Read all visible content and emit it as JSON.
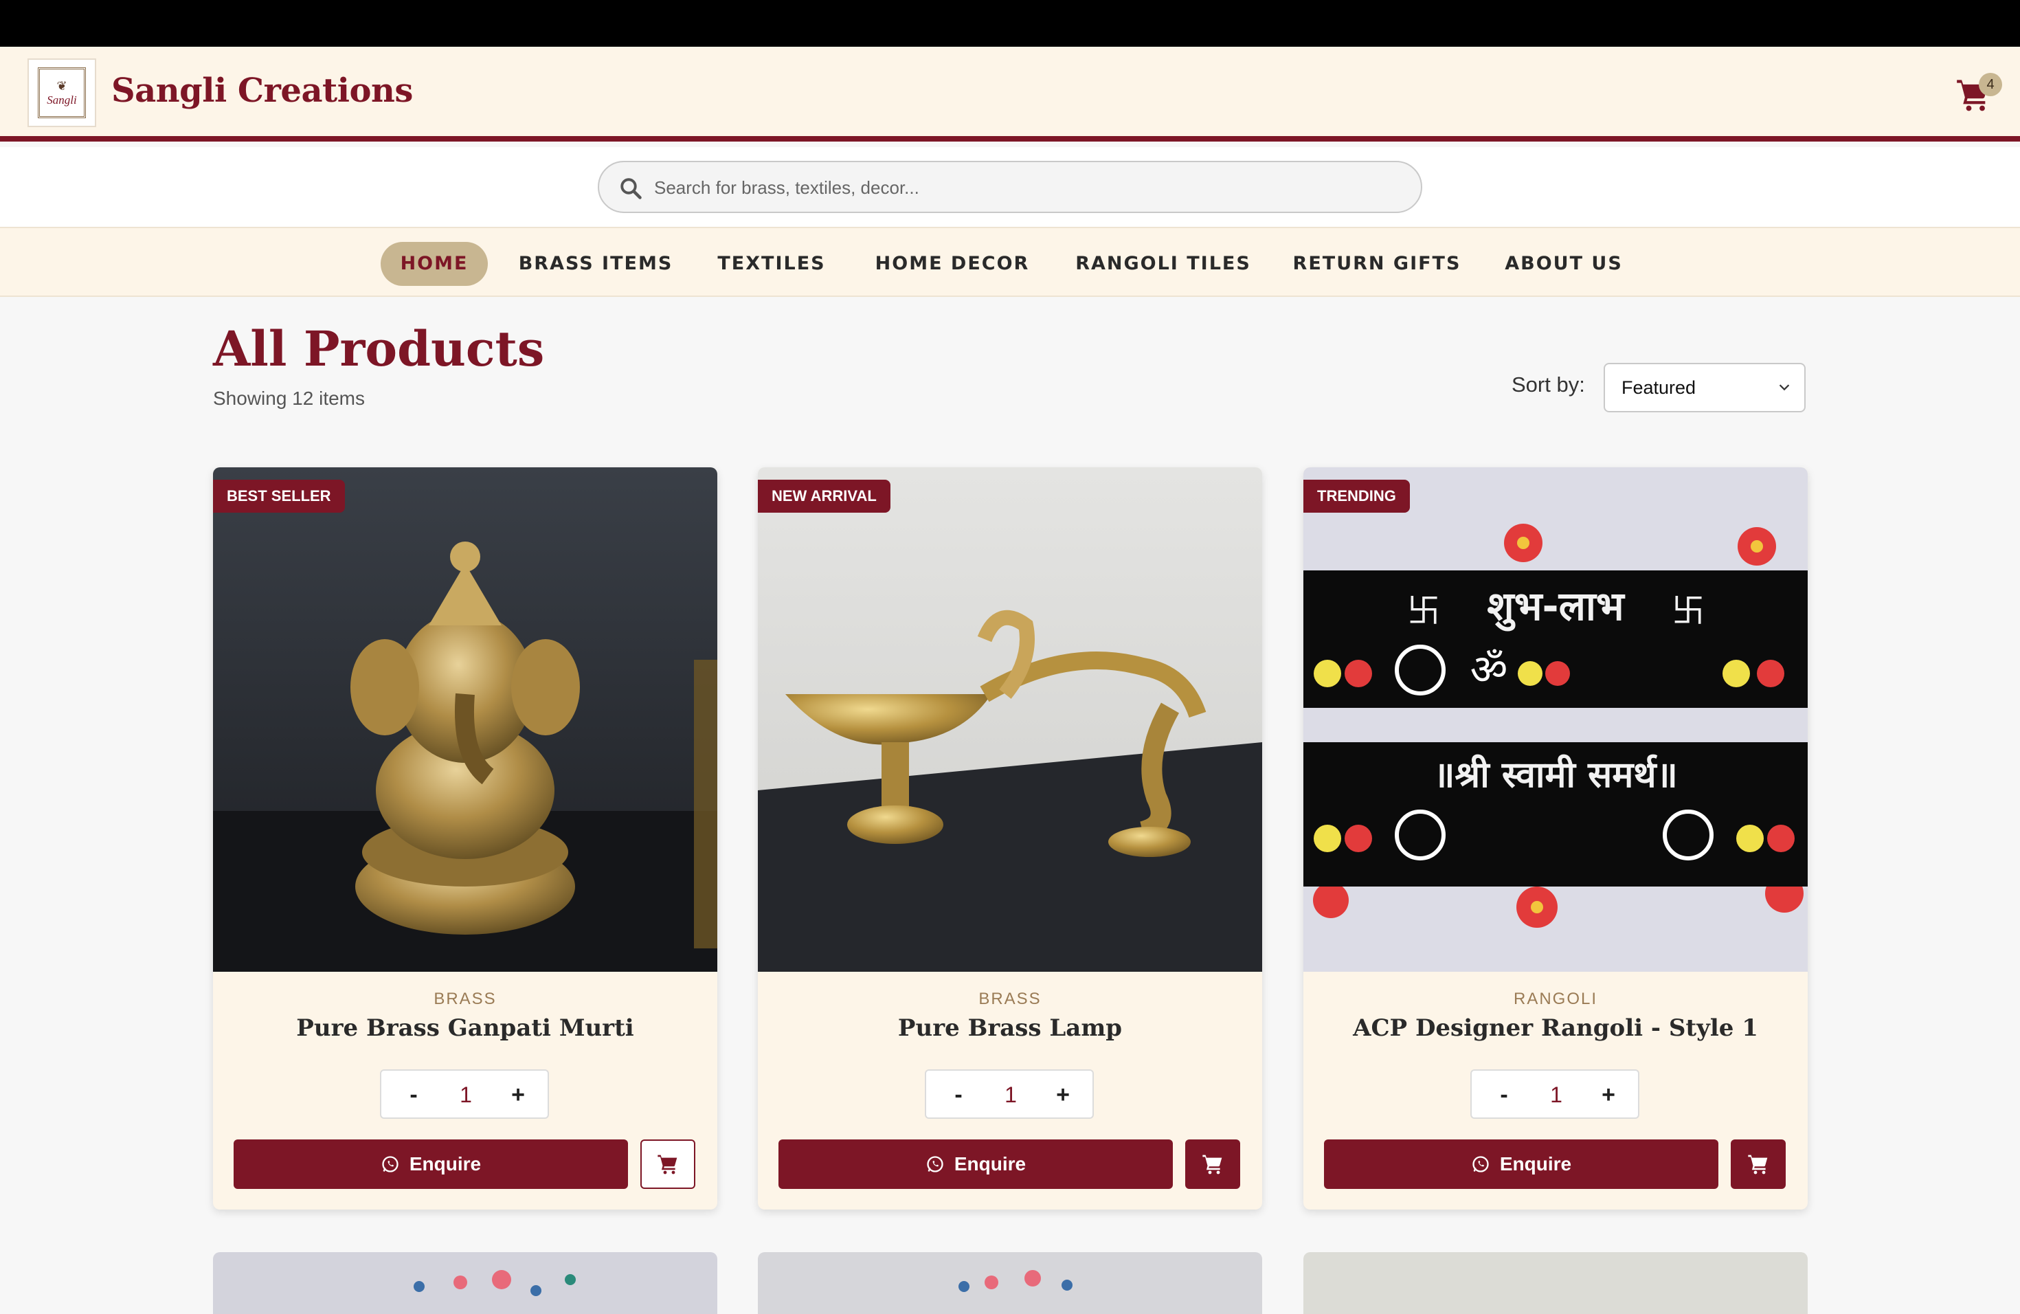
{
  "header": {
    "logo_text": "Sangli",
    "brand": "Sangli Creations",
    "cart_count": "4"
  },
  "search": {
    "placeholder": "Search for brass, textiles, decor...",
    "value": ""
  },
  "nav": {
    "items": [
      {
        "label": "HOME",
        "active": true
      },
      {
        "label": "BRASS ITEMS",
        "active": false
      },
      {
        "label": "TEXTILES",
        "active": false
      },
      {
        "label": "HOME DECOR",
        "active": false
      },
      {
        "label": "RANGOLI TILES",
        "active": false
      },
      {
        "label": "RETURN GIFTS",
        "active": false
      },
      {
        "label": "ABOUT US",
        "active": false
      }
    ]
  },
  "listing": {
    "title": "All Products",
    "count": "Showing 12 items",
    "sort_label": "Sort by:",
    "sort_value": "Featured"
  },
  "products": [
    {
      "tag": "BEST SELLER",
      "category": "BRASS",
      "name": "Pure Brass Ganpati Murti",
      "qty": "1",
      "enquire": "Enquire"
    },
    {
      "tag": "NEW ARRIVAL",
      "category": "BRASS",
      "name": "Pure Brass Lamp",
      "qty": "1",
      "enquire": "Enquire"
    },
    {
      "tag": "TRENDING",
      "category": "RANGOLI",
      "name": "ACP Designer Rangoli - Style 1",
      "qty": "1",
      "enquire": "Enquire"
    }
  ],
  "rangoli_text": {
    "line1": "शुभ-लाभ",
    "line2": "॥श्री स्वामी समर्थ॥"
  },
  "icons": {
    "cart": "shopping-cart-icon",
    "search": "search-icon",
    "whatsapp": "whatsapp-icon",
    "chevron": "chevron-down-icon"
  },
  "colors": {
    "brand": "#7d1626",
    "accent": "#c8b691",
    "cream": "#fdf5e8"
  }
}
